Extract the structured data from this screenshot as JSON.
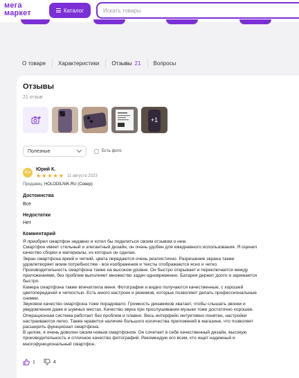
{
  "header": {
    "logo_line1": "мега",
    "logo_line2": "маркет",
    "catalog_label": "Каталог",
    "search_placeholder": "Искать товары"
  },
  "tabs": [
    {
      "label": "О товаре"
    },
    {
      "label": "Характеристики"
    },
    {
      "label": "Отзывы",
      "count": "21"
    },
    {
      "label": "Вопросы"
    }
  ],
  "reviews": {
    "title": "Отзывы",
    "count_text": "21 отзыв",
    "photo_more": "+1",
    "sort_label": "Полезные",
    "filter_label": "Есть фото"
  },
  "review": {
    "avatar_initials": "Юк",
    "author": "Юрий К.",
    "rating": 5,
    "date": "11 августа 2023",
    "seller_prefix": "Продавец:",
    "seller_name": "HOLODILNIK.RU (Север)",
    "pros_label": "Достоинства",
    "pros_value": "Все",
    "cons_label": "Недостатки",
    "cons_value": "Нет",
    "comment_label": "Комментарий",
    "comment_lines": [
      "Я приобрел смартфон недавно и хотел бы поделиться своим отзывом о нем.",
      "Смартфон имеет стильный и элегантный дизайн, он очень удобен для ежедневного использования. Я оценил качество сборки и материалы, из которых он сделан.",
      "Экран смартфона яркий и четкий, цвета передаются очень реалистично. Разрешение экрана также удовлетворяет моим потребностям - все изображения и тексты отображаются ясно и четко.",
      "Производительность смартфона также на высоком уровне. Он быстро открывает и переключается между приложениями, без проблем выполняет множество задач одновременно. Батарея держит долго и заряжается быстро.",
      "Камера смартфона также впечатлила меня. Фотографии и видео получаются качественные, с хорошей цветопередачей и четкостью. Есть много настроек и режимов, которые позволяют делать профессиональные снимки.",
      "Звуковое качество смартфона тоже порадовало. Громкость динамиков хватает, чтобы слышать звонки и уведомления даже в шумных местах. Качество звука при прослушивании музыки тоже достаточно хорошее.",
      "Операционная система работает без проблем и плавно. Весь интерфейс интуитивно понятен, настройки настраиваются легко. Также нравится наличие большого количества приложений в магазине, что позволяет расширить функционал смартфона.",
      "В целом, я очень доволен своим новым смартфоном. Он сочетает в себе качественный дизайн, высокую производительность и отличное качество фотографий. Рекомендую его всем, кто ищет надежный и многофункциональный смартфон."
    ],
    "likes": "1",
    "dislikes": "4"
  },
  "colors": {
    "accent": "#7b2fd6",
    "star": "#f5a623"
  }
}
